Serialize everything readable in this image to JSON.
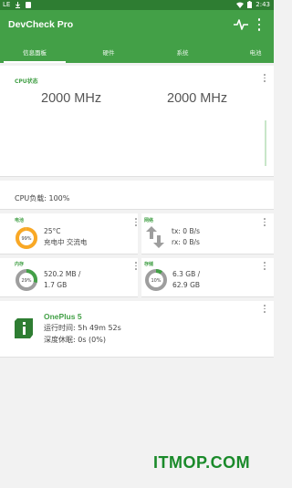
{
  "status_bar": {
    "left_icons": [
      "lte-icon",
      "download-icon",
      "android-icon"
    ],
    "left_text": "LE",
    "time": "2:43"
  },
  "app_bar": {
    "title": "DevCheck Pro"
  },
  "tabs": [
    {
      "label": "信息面板",
      "active": true
    },
    {
      "label": "硬件",
      "active": false
    },
    {
      "label": "系统",
      "active": false
    },
    {
      "label": "电池",
      "active": false
    }
  ],
  "cpu_status": {
    "title": "CPU状态",
    "freq_left": "2000 MHz",
    "freq_right": "2000 MHz"
  },
  "cpu_load": {
    "text": "CPU负载: 100%"
  },
  "battery": {
    "label": "电池",
    "percent": 99,
    "percent_text": "99%",
    "temp": "25°C",
    "status": "充电中 交流电"
  },
  "network": {
    "label": "网络",
    "tx": "tx: 0 B/s",
    "rx": "rx: 0 B/s"
  },
  "memory": {
    "label": "内存",
    "percent": 29,
    "percent_text": "29%",
    "used": "520.2 MB /",
    "total": "1.7 GB"
  },
  "storage": {
    "label": "存储",
    "percent": 10,
    "percent_text": "10%",
    "used": "6.3 GB /",
    "total": "62.9 GB"
  },
  "device": {
    "name": "OnePlus 5",
    "uptime": "运行时间: 5h 49m 52s",
    "deep_sleep": "深度休眠: 0s (0%)"
  },
  "watermark": {
    "text": "ITMOP.COM"
  },
  "colors": {
    "primary": "#43a047",
    "primary_dark": "#2e7d32",
    "accent_orange": "#f9a825"
  }
}
